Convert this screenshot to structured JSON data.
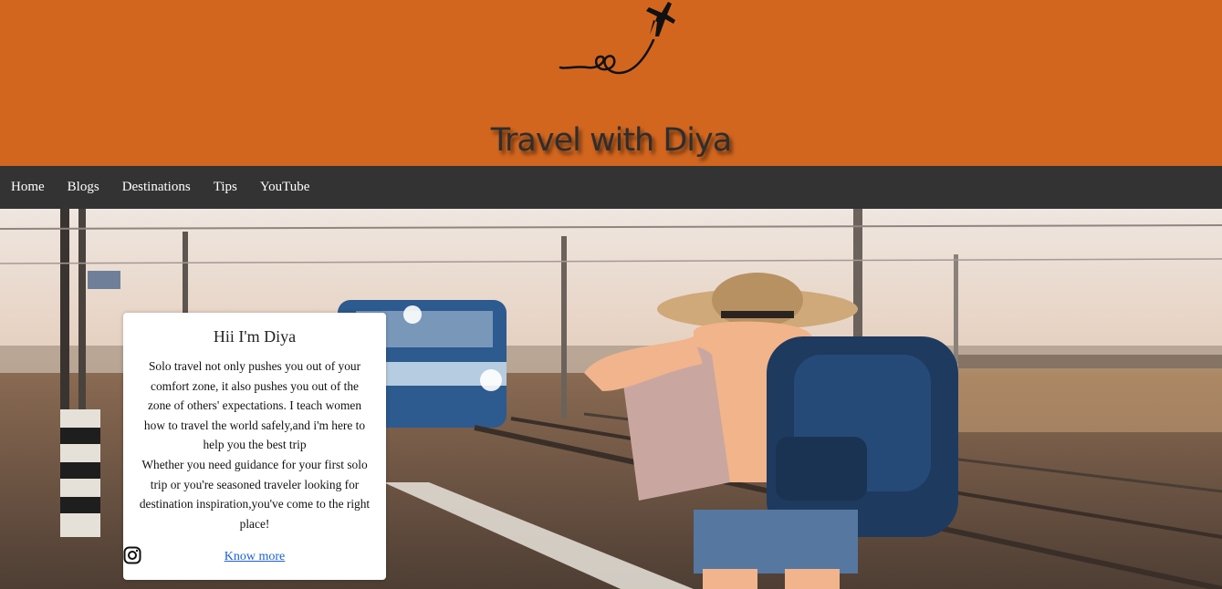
{
  "header": {
    "title": "Travel with Diya",
    "logo_icon": "airplane-icon",
    "background_color": "#d2661f"
  },
  "nav": {
    "background_color": "#333333",
    "items": [
      {
        "label": "Home"
      },
      {
        "label": "Blogs"
      },
      {
        "label": "Destinations"
      },
      {
        "label": "Tips"
      },
      {
        "label": "YouTube"
      }
    ]
  },
  "hero": {
    "card": {
      "title": "Hii I'm Diya",
      "paragraph_1": "Solo travel not only pushes you out of your comfort zone, it also pushes you out of the zone of others' expectations. I teach women how to travel the world safely,and i'm here to help you the best trip",
      "paragraph_2": "Whether you need guidance for your first solo trip or you're seasoned traveler looking for destination inspiration,you've come to the right place!",
      "link_label": "Know more",
      "social_icon": "instagram-icon",
      "link_color": "#1a5fd6"
    }
  }
}
